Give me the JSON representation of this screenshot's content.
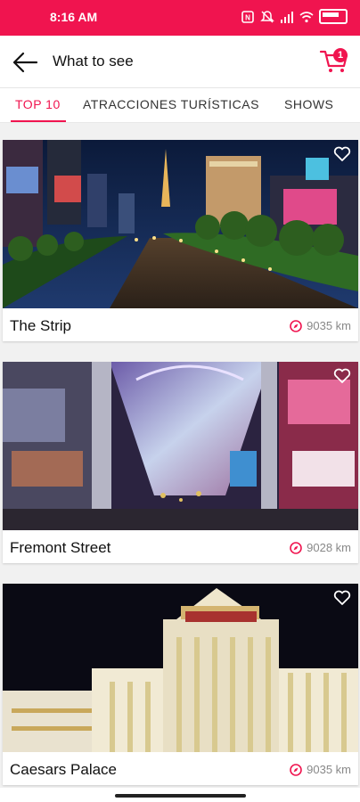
{
  "status_bar": {
    "time": "8:16 AM"
  },
  "header": {
    "title": "What to see",
    "cart_count": "1"
  },
  "tabs": [
    {
      "label": "TOP 10",
      "active": true
    },
    {
      "label": "ATRACCIONES TURÍSTICAS",
      "active": false
    },
    {
      "label": "SHOWS",
      "active": false
    }
  ],
  "places": [
    {
      "name": "The Strip",
      "distance": "9035 km"
    },
    {
      "name": "Fremont Street",
      "distance": "9028 km"
    },
    {
      "name": "Caesars Palace",
      "distance": "9035 km"
    }
  ],
  "colors": {
    "accent": "#f0144f"
  }
}
